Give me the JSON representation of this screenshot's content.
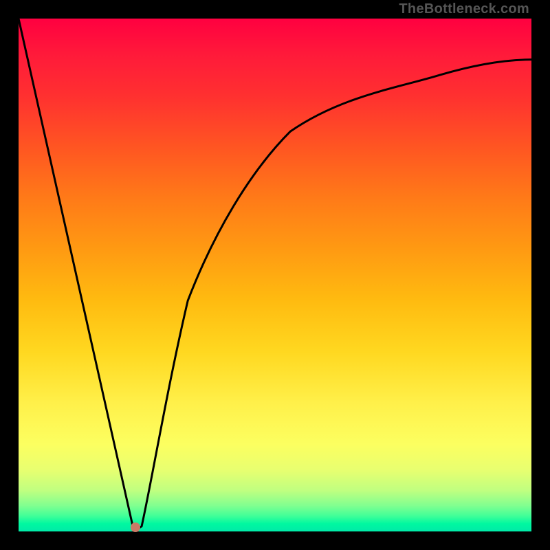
{
  "attribution": "TheBottleneck.com",
  "chart_data": {
    "type": "line",
    "title": "",
    "xlabel": "",
    "ylabel": "",
    "xlim": [
      0,
      100
    ],
    "ylim": [
      0,
      100
    ],
    "series": [
      {
        "name": "curve",
        "x": [
          0,
          22.5,
          24,
          26,
          29,
          33,
          38,
          45,
          53,
          62,
          72,
          82,
          92,
          100
        ],
        "y": [
          100,
          0,
          1,
          10,
          28,
          45,
          58,
          70,
          78,
          83.5,
          87,
          89.5,
          91.2,
          92
        ]
      }
    ],
    "vertex": {
      "x": 23,
      "y": 0
    },
    "background_gradient": {
      "top": "#ff0040",
      "mid": "#ffd820",
      "bottom": "#00eaa8"
    }
  }
}
